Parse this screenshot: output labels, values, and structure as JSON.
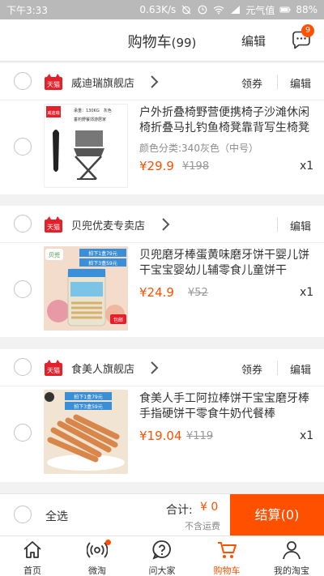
{
  "status_bar": {
    "time": "下午3:33",
    "speed": "0.63K/s",
    "carrier": "元气值",
    "battery": "88%"
  },
  "header": {
    "title": "购物车",
    "count": "(99)",
    "edit_label": "编辑",
    "message_badge": "9"
  },
  "stores": [
    {
      "name": "威迪瑞旗舰店",
      "coupon": "领券",
      "edit": "编辑",
      "item": {
        "title": "户外折叠椅野营便携椅子沙滩休闲椅折叠马扎钓鱼椅凳靠背写生椅凳",
        "sku": "颜色分类:340灰色（中号）",
        "price": "¥29.9",
        "original_price": "¥198",
        "qty": "x1",
        "thumb_brand": "威迪瑞",
        "thumb_spec1": "承重：130KG　灰色",
        "thumb_spec2": "垂钓野餐郊游居家"
      }
    },
    {
      "name": "贝兜优麦专卖店",
      "coupon": "",
      "edit": "编辑",
      "item": {
        "title": "贝兜磨牙棒蛋黄味磨牙饼干婴儿饼干宝宝婴幼儿辅零食儿童饼干",
        "sku": "",
        "price": "¥24.9",
        "original_price": "¥52",
        "qty": "x1",
        "thumb_brand": "贝兜",
        "thumb_promo1": "拍下1盒79元",
        "thumb_promo2": "拍下3盒59元",
        "thumb_tag": "包邮"
      }
    },
    {
      "name": "食美人旗舰店",
      "coupon": "领券",
      "edit": "编辑",
      "item": {
        "title": "食美人手工阿拉棒饼干宝宝磨牙棒手指硬饼干零食牛奶代餐棒",
        "sku": "",
        "price": "¥19.04",
        "original_price": "¥119",
        "qty": "x1",
        "thumb_promo1": "拍下1盒79元",
        "thumb_promo2": "拍下3盒59元"
      }
    }
  ],
  "footer": {
    "select_all": "全选",
    "total_label": "合计:",
    "total_value": "¥ 0",
    "shipping_note": "不含运费",
    "checkout_label": "结算(0)"
  },
  "tabbar": [
    {
      "label": "首页",
      "icon": "home-icon"
    },
    {
      "label": "微淘",
      "icon": "broadcast-icon"
    },
    {
      "label": "问大家",
      "icon": "question-icon"
    },
    {
      "label": "购物车",
      "icon": "cart-icon"
    },
    {
      "label": "我的淘宝",
      "icon": "person-icon"
    }
  ],
  "colors": {
    "accent": "#ff5000",
    "tmall_red": "#e4202b"
  }
}
